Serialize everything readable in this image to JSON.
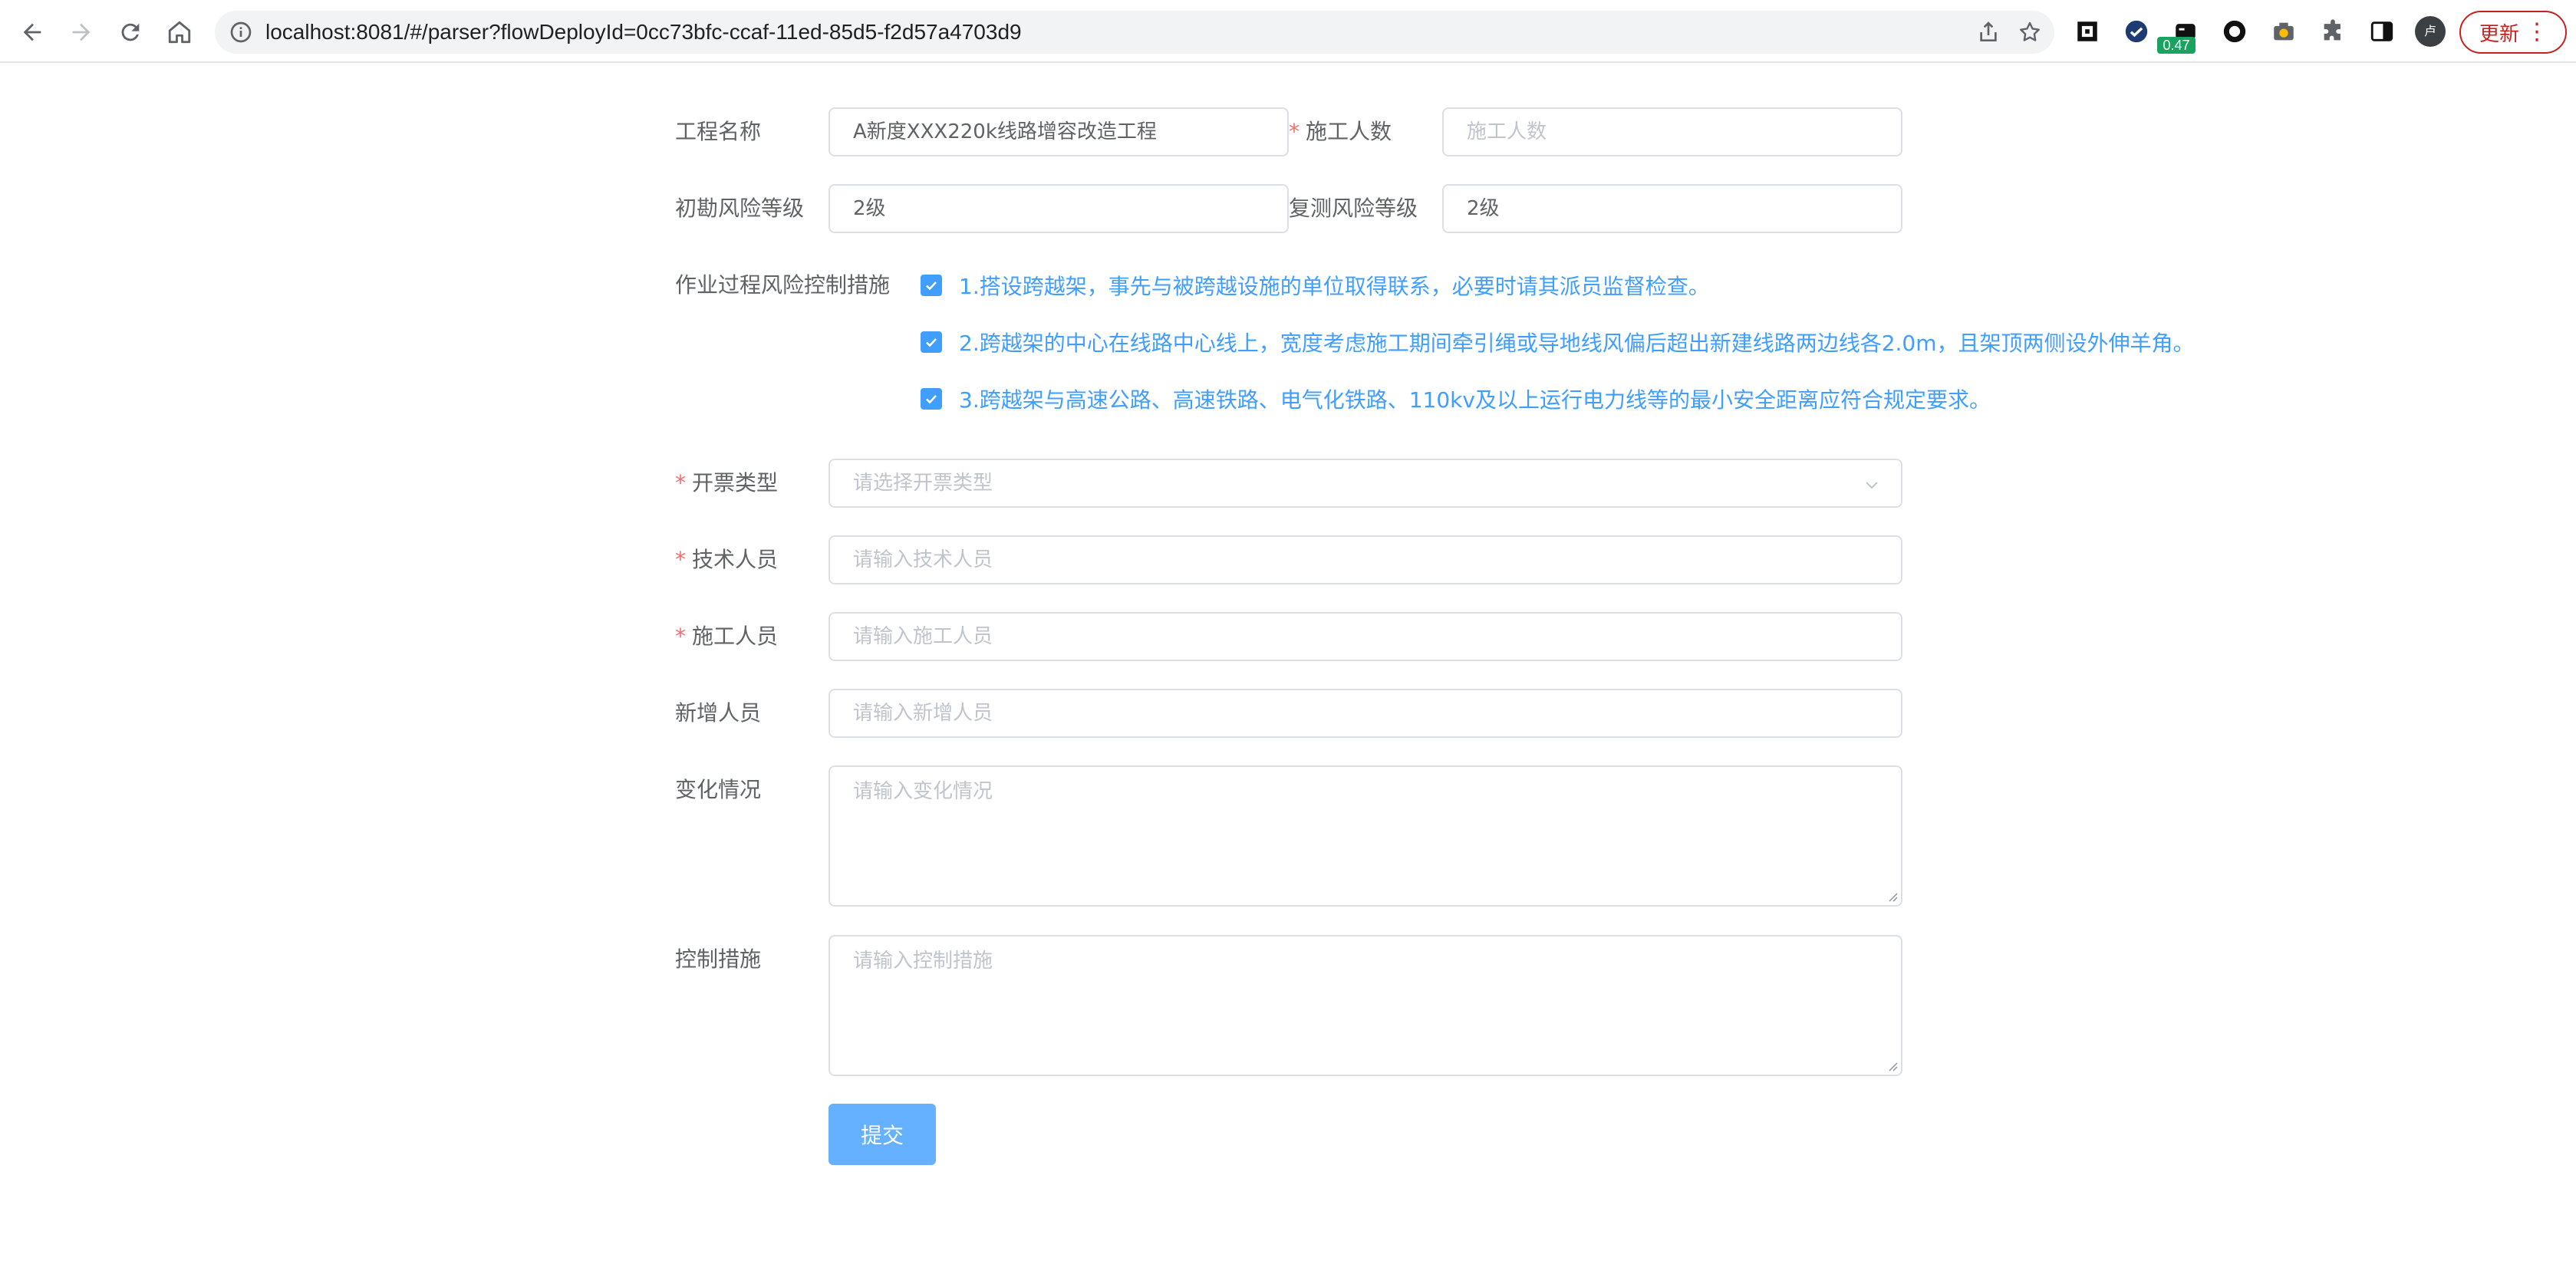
{
  "browser": {
    "url_host": "localhost",
    "url_rest": ":8081/#/parser?flowDeployId=0cc73bfc-ccaf-11ed-85d5-f2d57a4703d9",
    "extension_badge": "0.47",
    "avatar_initial": "卢",
    "update_label": "更新"
  },
  "form": {
    "project_name": {
      "label": "工程名称",
      "value": "A新度XXX220k线路增容改造工程"
    },
    "worker_count": {
      "label": "施工人数",
      "placeholder": "施工人数",
      "required": true
    },
    "initial_risk": {
      "label": "初勘风险等级",
      "value": "2级"
    },
    "retest_risk": {
      "label": "复测风险等级",
      "value": "2级"
    },
    "risk_measures": {
      "label": "作业过程风险控制措施",
      "items": [
        {
          "text": "1.搭设跨越架，事先与被跨越设施的单位取得联系，必要时请其派员监督检查。",
          "checked": true
        },
        {
          "text": "2.跨越架的中心在线路中心线上，宽度考虑施工期间牵引绳或导地线风偏后超出新建线路两边线各2.0m，且架顶两侧设外伸羊角。",
          "checked": true
        },
        {
          "text": "3.跨越架与高速公路、高速铁路、电气化铁路、110kv及以上运行电力线等的最小安全距离应符合规定要求。",
          "checked": true
        }
      ]
    },
    "ticket_type": {
      "label": "开票类型",
      "placeholder": "请选择开票类型",
      "required": true
    },
    "tech_staff": {
      "label": "技术人员",
      "placeholder": "请输入技术人员",
      "required": true
    },
    "construction_staff": {
      "label": "施工人员",
      "placeholder": "请输入施工人员",
      "required": true
    },
    "new_staff": {
      "label": "新增人员",
      "placeholder": "请输入新增人员"
    },
    "changes": {
      "label": "变化情况",
      "placeholder": "请输入变化情况"
    },
    "control_measures": {
      "label": "控制措施",
      "placeholder": "请输入控制措施"
    },
    "submit_label": "提交"
  },
  "colors": {
    "primary": "#409eff",
    "submit_bg": "#66b1ff",
    "required": "#f56c6c",
    "border": "#dcdfe6",
    "placeholder": "#c0c4cc",
    "update_red": "#c5221f"
  }
}
